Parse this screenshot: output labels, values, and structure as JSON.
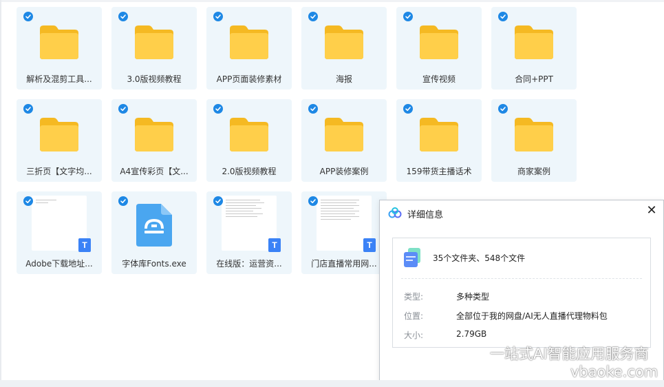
{
  "files": [
    {
      "name": "解析及混剪工具...",
      "type": "folder"
    },
    {
      "name": "3.0版视频教程",
      "type": "folder"
    },
    {
      "name": "APP页面装修素材",
      "type": "folder"
    },
    {
      "name": "海报",
      "type": "folder"
    },
    {
      "name": "宣传视频",
      "type": "folder"
    },
    {
      "name": "合同+PPT",
      "type": "folder"
    },
    {
      "name": "三折页【文字均...",
      "type": "folder"
    },
    {
      "name": "A4宣传彩页【文...",
      "type": "folder"
    },
    {
      "name": "2.0版视频教程",
      "type": "folder"
    },
    {
      "name": "APP装修案例",
      "type": "folder"
    },
    {
      "name": "159带货主播话术",
      "type": "folder"
    },
    {
      "name": "商家案例",
      "type": "folder"
    },
    {
      "name": "Adobe下载地址...",
      "type": "document"
    },
    {
      "name": "字体库Fonts.exe",
      "type": "exe"
    },
    {
      "name": "在线版：运营资...",
      "type": "document"
    },
    {
      "name": "门店直播常用网...",
      "type": "document"
    }
  ],
  "doc_badge": "T",
  "panel": {
    "title": "详细信息",
    "close_glyph": "✕",
    "summary": "35个文件夹、548个文件",
    "type_label": "类型:",
    "type_value": "多种类型",
    "location_label": "位置:",
    "location_value": "全部位于我的网盘/AI无人直播代理物料包",
    "size_label": "大小:",
    "size_value": "2.79GB"
  },
  "watermark": {
    "line1": "一站式AI智能应用服务商",
    "line2": "vbaoke.com"
  },
  "colors": {
    "tile_bg": "#eef6fb",
    "check": "#1e88e5",
    "folder": "#ffc93c",
    "doc_badge": "#3b82f6",
    "exe": "#4aa6f0"
  },
  "icons": [
    "check-icon",
    "folder-icon",
    "document-icon",
    "exe-icon",
    "close-icon",
    "baidu-netdisk-logo-icon",
    "multi-file-icon"
  ]
}
